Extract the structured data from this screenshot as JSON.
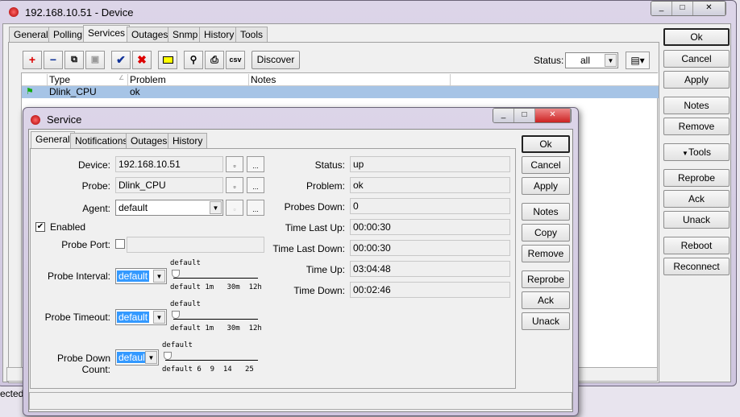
{
  "device": {
    "title": "192.168.10.51 - Device",
    "tabs": [
      "General",
      "Polling",
      "Services",
      "Outages",
      "Snmp",
      "History",
      "Tools"
    ],
    "active_tab": "Services",
    "toolbar": {
      "icons": [
        "add-icon",
        "remove-icon",
        "copy-icon",
        "paste-icon",
        "enable-check-icon",
        "disable-x-icon",
        "comment-icon",
        "find-binoculars-icon",
        "print-icon",
        "csv-icon"
      ],
      "csv": "csv",
      "discover": "Discover"
    },
    "status_label": "Status:",
    "status_value": "all",
    "table": {
      "columns": [
        "Type",
        "Problem",
        "Notes"
      ],
      "rows": [
        {
          "type": "Dlink_CPU",
          "problem": "ok",
          "notes": ""
        }
      ]
    },
    "buttons": [
      "Ok",
      "Cancel",
      "Apply",
      "Notes",
      "Remove",
      "Tools",
      "Reprobe",
      "Ack",
      "Unack",
      "Reboot",
      "Reconnect"
    ],
    "status_bar": "ected"
  },
  "service": {
    "title": "Service",
    "tabs": [
      "General",
      "Notifications",
      "Outages",
      "History"
    ],
    "active_tab": "General",
    "device_label": "Device:",
    "device": "192.168.10.51",
    "probe_label": "Probe:",
    "probe": "Dlink_CPU",
    "agent_label": "Agent:",
    "agent": "default",
    "enabled_label": "Enabled",
    "enabled": true,
    "probe_port_label": "Probe Port:",
    "probe_port": "",
    "probe_interval_label": "Probe Interval:",
    "probe_interval": "default",
    "probe_timeout_label": "Probe Timeout:",
    "probe_timeout": "default",
    "probe_down_count_label": "Probe Down Count:",
    "probe_down_count": "default",
    "slider_value": "default",
    "time_ticks": [
      "default",
      "1m",
      "30m",
      "12h"
    ],
    "count_ticks": [
      "default",
      "6",
      "9",
      "14",
      "25"
    ],
    "dots": "...",
    "status": [
      {
        "label": "Status:",
        "value": "up"
      },
      {
        "label": "Problem:",
        "value": "ok"
      },
      {
        "label": "Probes Down:",
        "value": "0"
      },
      {
        "label": "Time Last Up:",
        "value": "00:00:30"
      },
      {
        "label": "Time Last Down:",
        "value": "00:00:30"
      },
      {
        "label": "Time Up:",
        "value": "03:04:48"
      },
      {
        "label": "Time Down:",
        "value": "00:02:46"
      }
    ],
    "buttons": [
      "Ok",
      "Cancel",
      "Apply",
      "Notes",
      "Copy",
      "Remove",
      "Reprobe",
      "Ack",
      "Unack"
    ]
  }
}
